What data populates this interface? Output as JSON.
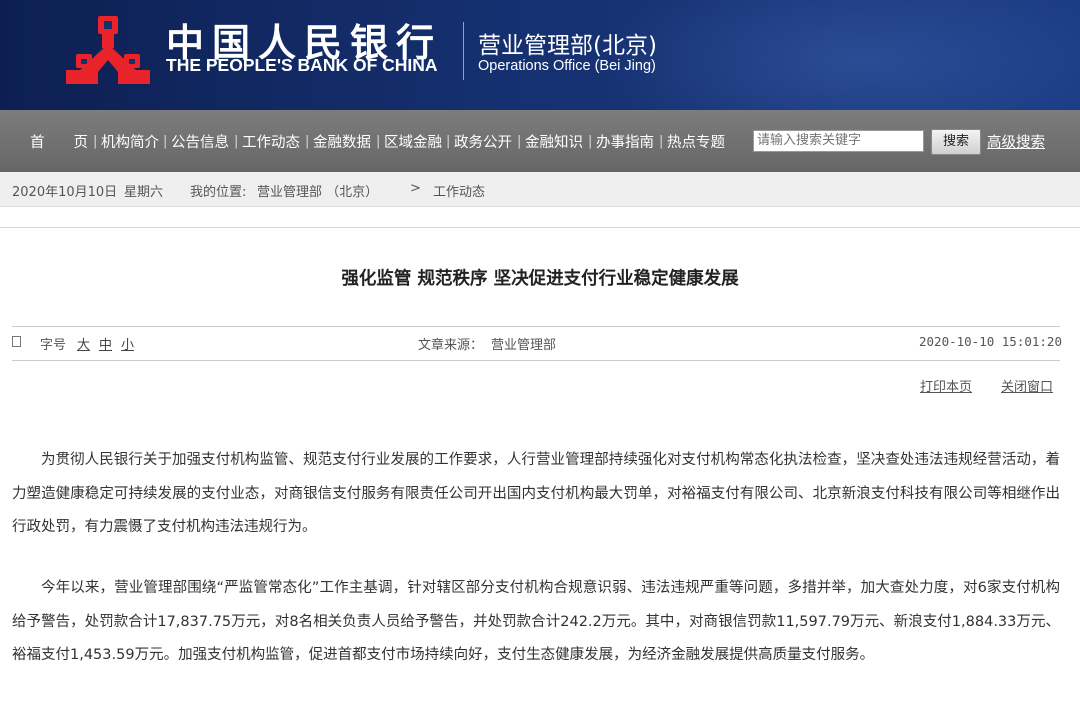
{
  "header": {
    "bank_name_cn": "中国人民银行",
    "bank_name_en": "THE PEOPLE'S BANK OF CHINA",
    "office_cn": "营业管理部(北京)",
    "office_en": "Operations Office (Bei Jing)",
    "logo_icon": "pboc-logo-icon",
    "colors": {
      "banner": "#15306f",
      "logo_red": "#e8232a"
    }
  },
  "nav": {
    "items": [
      "首　　页",
      "机构简介",
      "公告信息",
      "工作动态",
      "金融数据",
      "区域金融",
      "政务公开",
      "金融知识",
      "办事指南",
      "热点专题"
    ],
    "separator": "|",
    "search_placeholder": "请输入搜索关键字",
    "search_button": "搜索",
    "advanced_search": "高级搜索",
    "colors": {
      "bar": "#707070"
    }
  },
  "breadcrumb": {
    "date": "2020年10月10日",
    "weekday": "星期六",
    "location_label": "我的位置:",
    "location_path": "营业管理部 （北京）",
    "arrow": ">",
    "current": "工作动态"
  },
  "article": {
    "title": "强化监管  规范秩序  坚决促进支付行业稳定健康发展",
    "font_size_label": "字号",
    "font_sizes": [
      "大",
      "中",
      "小"
    ],
    "source_label": "文章来源：",
    "source": "营业管理部",
    "datetime": "2020-10-10 15:01:20",
    "print": "打印本页",
    "close": "关闭窗口",
    "paragraphs": [
      "为贯彻人民银行关于加强支付机构监管、规范支付行业发展的工作要求，人行营业管理部持续强化对支付机构常态化执法检查，坚决查处违法违规经营活动，着力塑造健康稳定可持续发展的支付业态，对商银信支付服务有限责任公司开出国内支付机构最大罚单，对裕福支付有限公司、北京新浪支付科技有限公司等相继作出行政处罚，有力震慑了支付机构违法违规行为。",
      "今年以来，营业管理部围绕“严监管常态化”工作主基调，针对辖区部分支付机构合规意识弱、违法违规严重等问题，多措并举，加大查处力度，对6家支付机构给予警告，处罚款合计17,837.75万元，对8名相关负责人员给予警告，并处罚款合计242.2万元。其中，对商银信罚款11,597.79万元、新浪支付1,884.33万元、裕福支付1,453.59万元。加强支付机构监管，促进首都支付市场持续向好，支付生态健康发展，为经济金融发展提供高质量支付服务。"
    ]
  }
}
